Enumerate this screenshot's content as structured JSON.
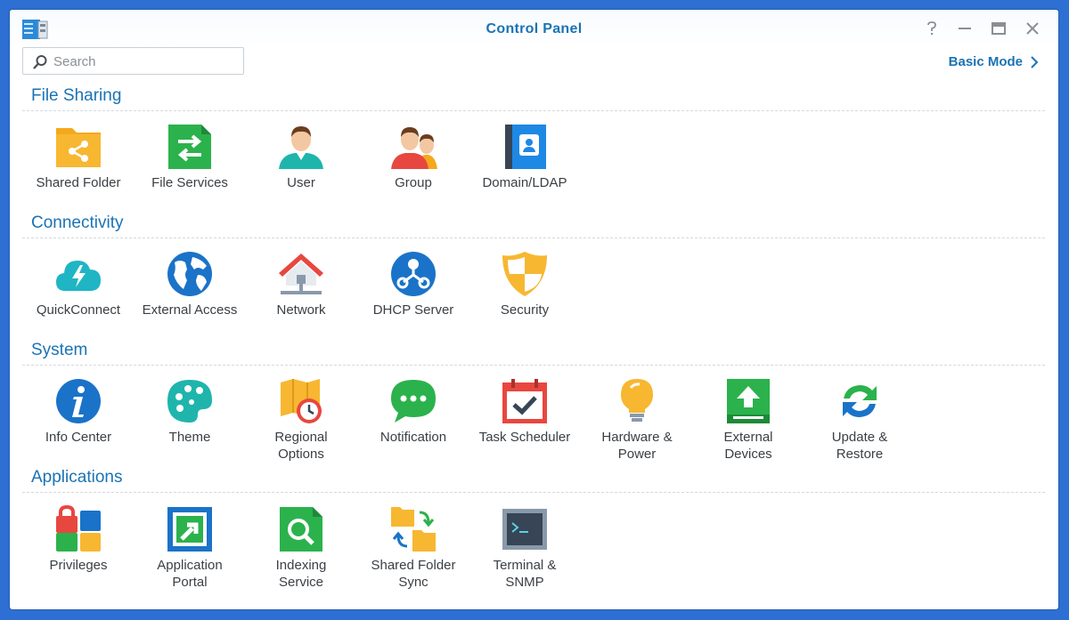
{
  "window": {
    "title": "Control Panel",
    "controls": [
      "help",
      "minimize",
      "maximize",
      "close"
    ]
  },
  "search": {
    "placeholder": "Search"
  },
  "mode_link": {
    "label": "Basic Mode"
  },
  "sections": [
    {
      "title": "File Sharing",
      "items": [
        {
          "label": "Shared Folder",
          "icon": "shared-folder-icon"
        },
        {
          "label": "File Services",
          "icon": "file-services-icon"
        },
        {
          "label": "User",
          "icon": "user-icon"
        },
        {
          "label": "Group",
          "icon": "group-icon"
        },
        {
          "label": "Domain/LDAP",
          "icon": "domain-ldap-icon"
        }
      ]
    },
    {
      "title": "Connectivity",
      "items": [
        {
          "label": "QuickConnect",
          "icon": "quickconnect-icon"
        },
        {
          "label": "External Access",
          "icon": "external-access-icon"
        },
        {
          "label": "Network",
          "icon": "network-icon"
        },
        {
          "label": "DHCP Server",
          "icon": "dhcp-server-icon"
        },
        {
          "label": "Security",
          "icon": "security-icon"
        }
      ]
    },
    {
      "title": "System",
      "items": [
        {
          "label": "Info Center",
          "icon": "info-center-icon"
        },
        {
          "label": "Theme",
          "icon": "theme-icon"
        },
        {
          "label": "Regional Options",
          "icon": "regional-options-icon"
        },
        {
          "label": "Notification",
          "icon": "notification-icon"
        },
        {
          "label": "Task Scheduler",
          "icon": "task-scheduler-icon"
        },
        {
          "label": "Hardware & Power",
          "icon": "hardware-power-icon"
        },
        {
          "label": "External Devices",
          "icon": "external-devices-icon"
        },
        {
          "label": "Update & Restore",
          "icon": "update-restore-icon"
        }
      ]
    },
    {
      "title": "Applications",
      "items": [
        {
          "label": "Privileges",
          "icon": "privileges-icon"
        },
        {
          "label": "Application Portal",
          "icon": "application-portal-icon"
        },
        {
          "label": "Indexing Service",
          "icon": "indexing-service-icon"
        },
        {
          "label": "Shared Folder Sync",
          "icon": "shared-folder-sync-icon"
        },
        {
          "label": "Terminal & SNMP",
          "icon": "terminal-snmp-icon"
        }
      ]
    }
  ],
  "colors": {
    "accent": "#1a73b4",
    "desktop": "#2d6fd2"
  }
}
